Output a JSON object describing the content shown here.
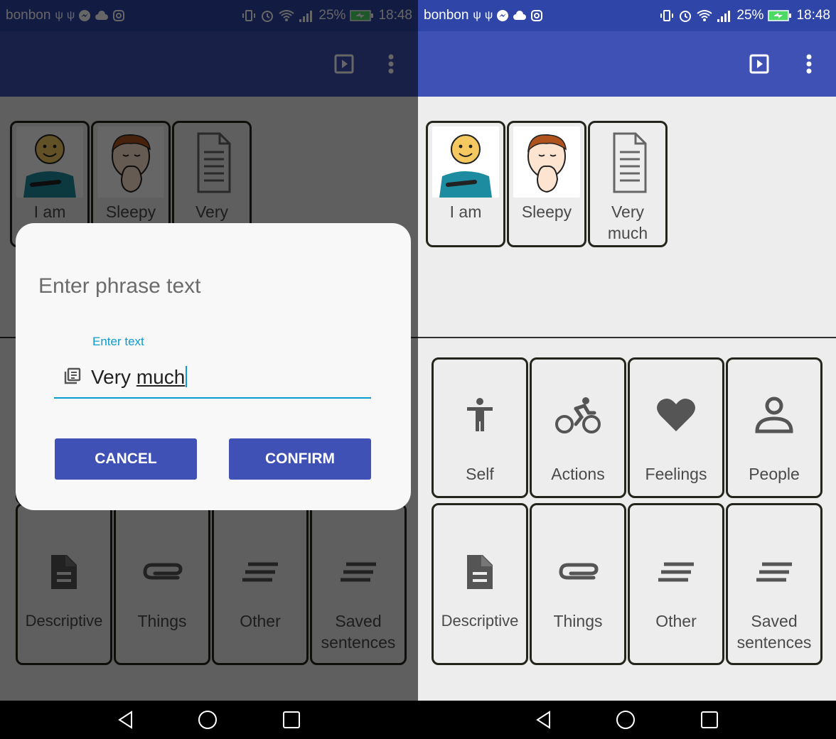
{
  "statusbar": {
    "carrier": "bonbon",
    "notification_icons": [
      "usb-icon",
      "usb-icon",
      "messenger-icon",
      "cloud-icon",
      "instagram-icon"
    ],
    "system_icons": [
      "vibrate-icon",
      "alarm-icon",
      "wifi-icon",
      "signal-icon"
    ],
    "battery": "25%",
    "time": "18:48"
  },
  "appbar": {
    "actions": [
      "play-icon",
      "more-vert-icon"
    ]
  },
  "sentence": {
    "tiles": [
      {
        "label": "I am",
        "icon": "boy-pointing-self-picture"
      },
      {
        "label": "Sleepy",
        "icon": "boy-yawning-picture"
      },
      {
        "label": "Very much",
        "icon": "document-icon"
      }
    ]
  },
  "categories": [
    {
      "label": "Self",
      "icon": "person-icon"
    },
    {
      "label": "Actions",
      "icon": "bike-icon"
    },
    {
      "label": "Feelings",
      "icon": "heart-icon"
    },
    {
      "label": "People",
      "icon": "person-outline-icon"
    },
    {
      "label": "Descriptive",
      "icon": "file-icon"
    },
    {
      "label": "Things",
      "icon": "paperclip-icon"
    },
    {
      "label": "Other",
      "icon": "short-text-icon"
    },
    {
      "label": "Saved sentences",
      "icon": "short-text-icon"
    }
  ],
  "dialog": {
    "title": "Enter phrase text",
    "field_label": "Enter text",
    "field_value_plain": "Very ",
    "field_value_underlined": "much",
    "cancel_label": "CANCEL",
    "confirm_label": "CONFIRM"
  },
  "colors": {
    "primary": "#3f51b5",
    "primary_dark": "#2f46a8",
    "accent": "#0a9bd2",
    "background": "#ededed",
    "tile_border": "#24241c"
  }
}
